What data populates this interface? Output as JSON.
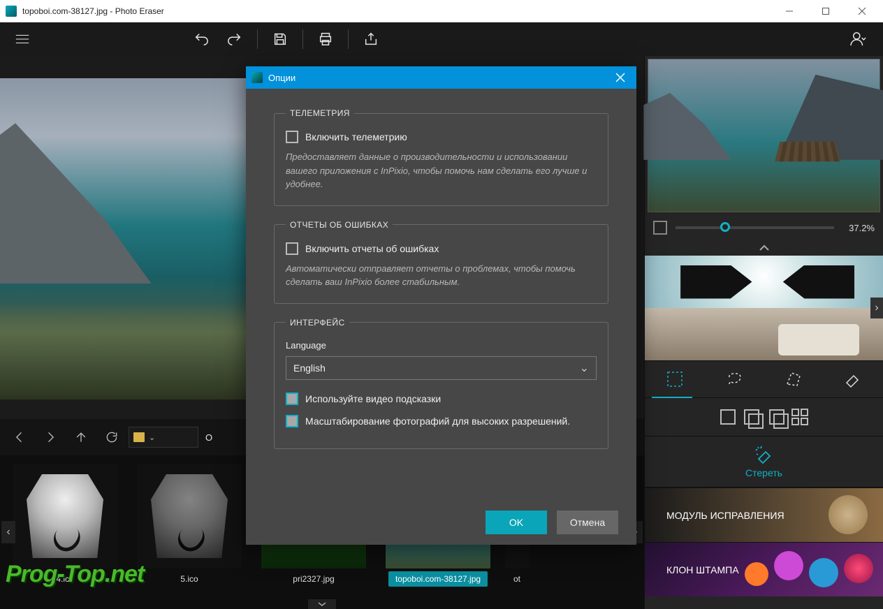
{
  "titlebar": {
    "title": "topoboi.com-38127.jpg - Photo Eraser"
  },
  "filebar": {
    "path_visible": "O"
  },
  "thumbs": [
    {
      "name": "4.ico"
    },
    {
      "name": "5.ico"
    },
    {
      "name": "pri2327.jpg"
    },
    {
      "name": "topoboi.com-38127.jpg",
      "selected": true
    },
    {
      "name": "ot"
    }
  ],
  "right": {
    "zoom": "37.2%",
    "slider_pct": 28,
    "action_label": "Стереть",
    "section_patch": "МОДУЛЬ ИСПРАВЛЕНИЯ",
    "section_clone": "КЛОН ШТАМПА"
  },
  "modal": {
    "title": "Опции",
    "group_telemetry": {
      "legend": "ТЕЛЕМЕТРИЯ",
      "checkbox_label": "Включить телеметрию",
      "description": "Предоставляет данные о производительности и использовании вашего приложения с InPixio, чтобы помочь нам сделать его лучше и удобнее."
    },
    "group_errors": {
      "legend": "ОТЧЕТЫ ОБ ОШИБКАХ",
      "checkbox_label": "Включить отчеты об ошибках",
      "description": "Автоматически отправляет отчеты о проблемах, чтобы помочь сделать ваш InPixio более стабильным."
    },
    "group_interface": {
      "legend": "ИНТЕРФЕЙС",
      "language_label": "Language",
      "language_value": "English",
      "hint_video": "Используйте видео подсказки",
      "scale_photos": "Масштабирование фотографий для высоких разрешений."
    },
    "ok": "OK",
    "cancel": "Отмена"
  },
  "watermark": "Prog-Top.net"
}
